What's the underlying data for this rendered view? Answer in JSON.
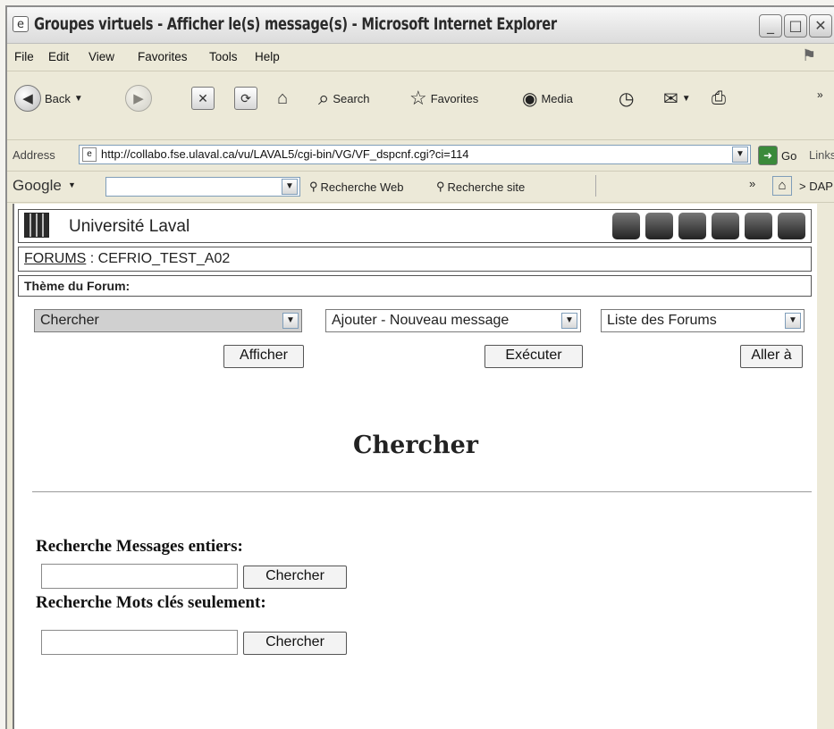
{
  "window": {
    "title": "Groupes virtuels - Afficher le(s) message(s) - Microsoft Internet Explorer"
  },
  "menu": [
    "File",
    "Edit",
    "View",
    "Favorites",
    "Tools",
    "Help"
  ],
  "toolbar": {
    "back_label": "Back",
    "search_label": "Search",
    "favorites_label": "Favorites",
    "media_label": "Media"
  },
  "address": {
    "label": "Address",
    "url": "http://collabo.fse.ulaval.ca/vu/LAVAL5/cgi-bin/VG/VF_dspcnf.cgi?ci=114",
    "go_label": "Go",
    "links_label": "Links"
  },
  "google": {
    "logo": "Google",
    "web_search_label": "Recherche Web",
    "site_search_label": "Recherche site",
    "dap_label": "DAP"
  },
  "header": {
    "university": "Université Laval"
  },
  "forum": {
    "forums_link": "FORUMS",
    "separator": " : ",
    "forum_name": "CEFRIO_TEST_A02",
    "theme_label": "Thème du Forum:"
  },
  "controls": {
    "select1_value": "Chercher",
    "select1_button": "Afficher",
    "select2_value": "Ajouter - Nouveau message",
    "select2_button": "Exécuter",
    "select3_value": "Liste des Forums",
    "select3_button": "Aller à"
  },
  "main": {
    "title": "Chercher",
    "search_full_label": "Recherche  Messages entiers:",
    "search_full_button": "Chercher",
    "search_keywords_label": "Recherche  Mots clés seulement:",
    "search_keywords_button": "Chercher"
  }
}
